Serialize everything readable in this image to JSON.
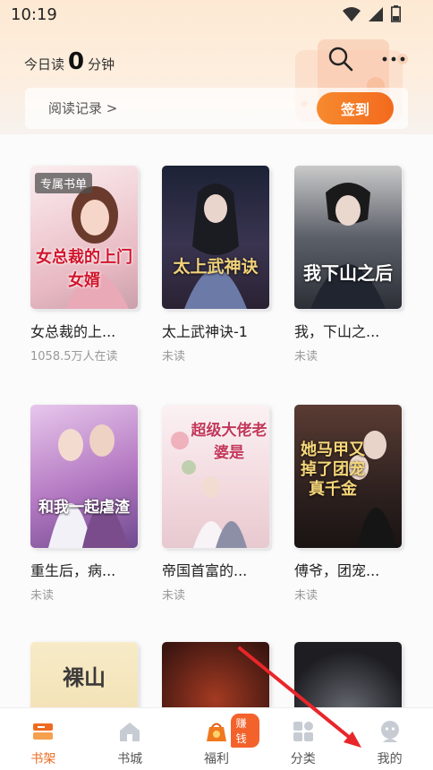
{
  "status_bar": {
    "time": "10:19"
  },
  "header": {
    "reading_prefix": "今日读",
    "reading_minutes": "0",
    "reading_suffix": "分钟",
    "history_link": "阅读记录 >",
    "signin_button": "签到"
  },
  "books": [
    {
      "title": "女总裁的上...",
      "status": "1058.5万人在读",
      "badge": "专属书单",
      "cover_text": "女总裁的上门女婿",
      "cover_color": "#f3dbe0"
    },
    {
      "title": "太上武神诀-1",
      "status": "未读",
      "badge": "",
      "cover_text": "太上武神诀",
      "cover_color": "#2c3350"
    },
    {
      "title": "我，下山之...",
      "status": "未读",
      "badge": "",
      "cover_text": "我下山之后",
      "cover_color": "#3a3e48"
    },
    {
      "title": "重生后，病...",
      "status": "未读",
      "badge": "",
      "cover_text": "和我一起虐渣",
      "cover_color": "#c58ac9"
    },
    {
      "title": "帝国首富的...",
      "status": "未读",
      "badge": "",
      "cover_text": "超级大佬老婆是",
      "cover_color": "#f6e6ea"
    },
    {
      "title": "傅爷，团宠...",
      "status": "未读",
      "badge": "",
      "cover_text": "她马甲又掉了团宠真千金",
      "cover_color": "#3b2b28"
    },
    {
      "title": "",
      "status": "",
      "badge": "",
      "cover_text": "裸山",
      "cover_color": "#f4e6c4"
    },
    {
      "title": "",
      "status": "",
      "badge": "",
      "cover_text": "",
      "cover_color": "#3b1510"
    },
    {
      "title": "",
      "status": "",
      "badge": "",
      "cover_text": "",
      "cover_color": "#1d1d22"
    }
  ],
  "nav": {
    "items": [
      {
        "label": "书架",
        "icon": "bookshelf-icon",
        "active": true
      },
      {
        "label": "书城",
        "icon": "bookstore-icon",
        "active": false
      },
      {
        "label": "福利",
        "icon": "gift-bag-icon",
        "active": false,
        "badge": "赚钱"
      },
      {
        "label": "分类",
        "icon": "category-grid-icon",
        "active": false
      },
      {
        "label": "我的",
        "icon": "profile-icon",
        "active": false
      }
    ]
  },
  "colors": {
    "accent": "#ef6b20",
    "annotation_arrow": "#e8262a"
  }
}
